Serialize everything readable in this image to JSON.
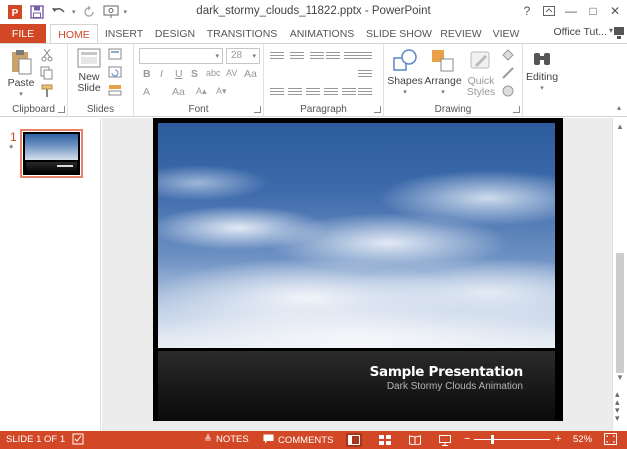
{
  "window": {
    "title": "dark_stormy_clouds_11822.pptx - PowerPoint",
    "help": "?",
    "minimize": "—",
    "restore": "□",
    "close": "✕"
  },
  "tabs": {
    "file": "FILE",
    "items": [
      "HOME",
      "INSERT",
      "DESIGN",
      "TRANSITIONS",
      "ANIMATIONS",
      "SLIDE SHOW",
      "REVIEW",
      "VIEW"
    ],
    "active": "HOME",
    "account": "Office Tut..."
  },
  "ribbon": {
    "clipboard": {
      "label": "Clipboard",
      "paste": "Paste"
    },
    "slides": {
      "label": "Slides",
      "new_slide_line1": "New",
      "new_slide_line2": "Slide"
    },
    "font": {
      "label": "Font",
      "size": "28"
    },
    "paragraph": {
      "label": "Paragraph"
    },
    "drawing": {
      "label": "Drawing",
      "shapes": "Shapes",
      "arrange": "Arrange",
      "quick_styles_line1": "Quick",
      "quick_styles_line2": "Styles"
    },
    "editing": {
      "label": "Editing"
    }
  },
  "thumbnails": {
    "slide_number": "1",
    "star": "*"
  },
  "slide": {
    "title": "Sample Presentation",
    "subtitle": "Dark Stormy Clouds Animation"
  },
  "statusbar": {
    "slide_info": "SLIDE 1 OF 1",
    "notes": "NOTES",
    "comments": "COMMENTS",
    "zoom_minus": "−",
    "zoom_plus": "+",
    "zoom": "52%",
    "zoom_level": 0.52,
    "active_view": "normal"
  },
  "colors": {
    "accent": "#d24726",
    "sky_top": "#2c5c9e",
    "footer_band": "#1d1d1d"
  }
}
